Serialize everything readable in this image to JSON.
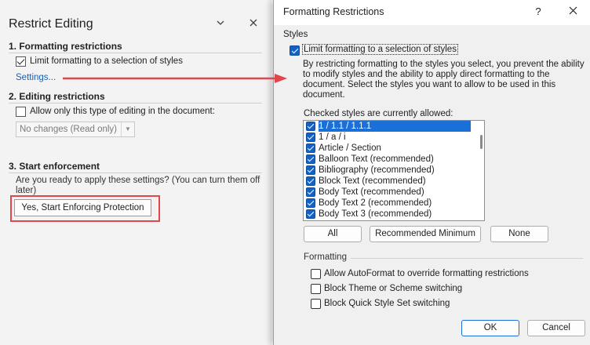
{
  "restrict_pane": {
    "title": "Restrict Editing",
    "section1": {
      "title": "1. Formatting restrictions",
      "checkbox_label": "Limit formatting to a selection of styles",
      "checked": true,
      "settings_link": "Settings..."
    },
    "section2": {
      "title": "2. Editing restrictions",
      "checkbox_label": "Allow only this type of editing in the document:",
      "checked": false,
      "dropdown_value": "No changes (Read only)"
    },
    "section3": {
      "title": "3. Start enforcement",
      "description": "Are you ready to apply these settings? (You can turn them off later)",
      "button_label": "Yes, Start Enforcing Protection"
    }
  },
  "dialog": {
    "title": "Formatting Restrictions",
    "help_glyph": "?",
    "styles_group_label": "Styles",
    "limit_checkbox_label": "Limit formatting to a selection of styles",
    "limit_checked": true,
    "description": "By restricting formatting to the styles you select, you prevent the ability to modify styles and the ability to apply direct formatting to the document. Select the styles you want to allow to be used in this document.",
    "list_caption": "Checked styles are currently allowed:",
    "styles": [
      {
        "label": "1 / 1.1 / 1.1.1",
        "checked": true,
        "selected": true
      },
      {
        "label": "1 / a / i",
        "checked": true,
        "selected": false
      },
      {
        "label": "Article / Section",
        "checked": true,
        "selected": false
      },
      {
        "label": "Balloon Text (recommended)",
        "checked": true,
        "selected": false
      },
      {
        "label": "Bibliography (recommended)",
        "checked": true,
        "selected": false
      },
      {
        "label": "Block Text (recommended)",
        "checked": true,
        "selected": false
      },
      {
        "label": "Body Text (recommended)",
        "checked": true,
        "selected": false
      },
      {
        "label": "Body Text 2 (recommended)",
        "checked": true,
        "selected": false
      },
      {
        "label": "Body Text 3 (recommended)",
        "checked": true,
        "selected": false
      }
    ],
    "buttons": {
      "all": "All",
      "recommended": "Recommended Minimum",
      "none": "None",
      "ok": "OK",
      "cancel": "Cancel"
    },
    "formatting_group_label": "Formatting",
    "formatting_options": [
      {
        "label": "Allow AutoFormat to override formatting restrictions",
        "checked": false
      },
      {
        "label": "Block Theme or Scheme switching",
        "checked": false
      },
      {
        "label": "Block Quick Style Set switching",
        "checked": false
      }
    ]
  },
  "colors": {
    "accent": "#1460c3",
    "highlight_red": "#e0464b",
    "selection": "#1a6fd8"
  }
}
